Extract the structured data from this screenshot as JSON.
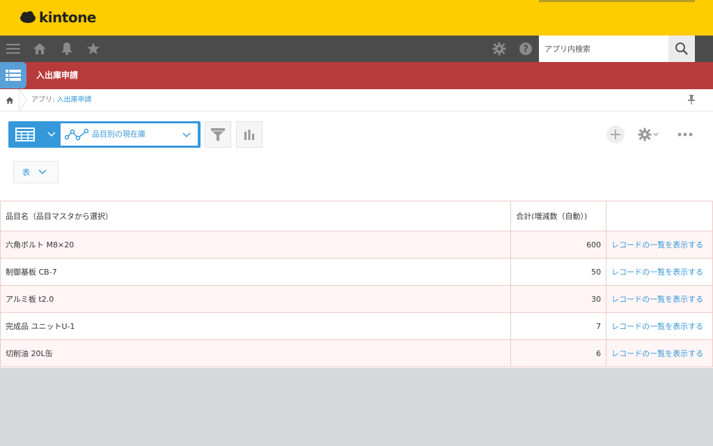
{
  "brand": {
    "name": "kintone"
  },
  "nav": {
    "search_placeholder": "アプリ内検索"
  },
  "app": {
    "title": "入出庫申請"
  },
  "breadcrumb": {
    "prefix": "アプリ: ",
    "app_link": "入出庫申請"
  },
  "view": {
    "selected_graph": "品目別の現在庫",
    "display_type": "表"
  },
  "table": {
    "headers": [
      "品目名（品目マスタから選択）",
      "合計(増減数（自動）)",
      ""
    ],
    "rows": [
      {
        "name": "六角ボルト M8×20",
        "total": "600",
        "link": "レコードの一覧を表示する"
      },
      {
        "name": "制御基板 CB-7",
        "total": "50",
        "link": "レコードの一覧を表示する"
      },
      {
        "name": "アルミ板 t2.0",
        "total": "30",
        "link": "レコードの一覧を表示する"
      },
      {
        "name": "完成品 ユニットU-1",
        "total": "7",
        "link": "レコードの一覧を表示する"
      },
      {
        "name": "切削油 20L缶",
        "total": "6",
        "link": "レコードの一覧を表示する"
      }
    ]
  },
  "colors": {
    "header": "#ffcc00",
    "nav": "#4b4b4b",
    "appbar": "#b83b3b",
    "accent": "#3498db"
  },
  "icons": [
    "menu-icon",
    "home-icon",
    "bell-icon",
    "star-icon",
    "gear-icon",
    "help-icon",
    "search-icon",
    "app-list-icon",
    "pin-icon",
    "table-view-icon",
    "graph-icon",
    "filter-icon",
    "bar-chart-icon",
    "plus-icon",
    "more-icon"
  ]
}
